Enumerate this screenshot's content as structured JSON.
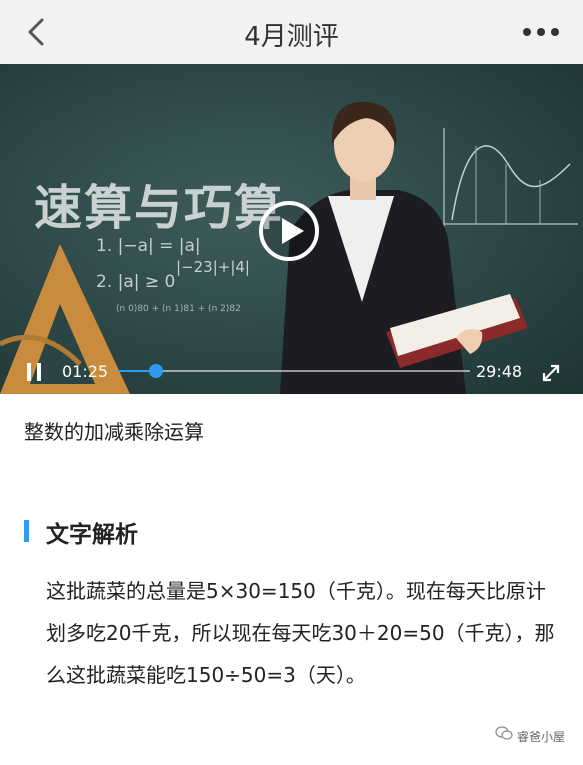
{
  "nav": {
    "title": "4月测评",
    "back_icon": "chevron-left-icon",
    "more_icon": "more-dots-icon"
  },
  "video": {
    "board_title": "速算与巧算",
    "formula_1": "1. |−a| = |a|",
    "formula_2": "|−23|+|4|",
    "formula_3": "2. |a| ≥ 0",
    "formula_4": "(n 0)80 + (n 1)81 + (n 2)82",
    "current_time": "01:25",
    "total_time": "29:48",
    "progress": 0.108
  },
  "video_title": "整数的加减乘除运算",
  "section": {
    "title": "文字解析",
    "accent_color": "#2e9bf0"
  },
  "analysis": "这批蔬菜的总量是5×30=150（千克）。现在每天比原计划多吃20千克，所以现在每天吃30＋20=50（千克），那么这批蔬菜能吃150÷50=3（天）。",
  "watermark": "睿爸小屋"
}
